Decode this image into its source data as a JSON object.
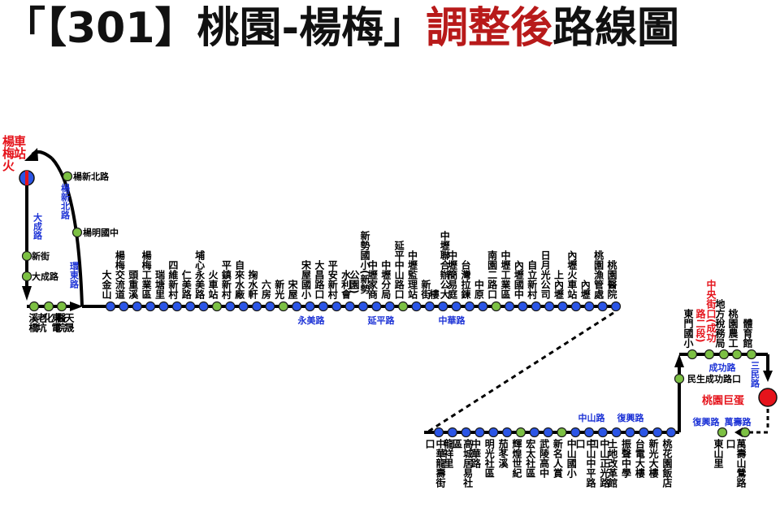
{
  "title": {
    "part1": "「【301】桃園-楊梅」",
    "part2": "調整後",
    "part3": "路線圖"
  },
  "colors": {
    "route": "#000000",
    "stop_blue": "#2b55e6",
    "stop_green": "#7cc043",
    "road_label": "#1d33d6",
    "terminal_red": "#e5131b",
    "title_red": "#b81a1a"
  },
  "terminal_yangmei": "楊梅火車站",
  "terminal_taoyuan": "桃園巨蛋",
  "left_stops": [
    "楊新北路",
    "楊明國中",
    "新街",
    "大成路"
  ],
  "bottom_left_stops": [
    "老坑溪橋",
    "東電化",
    "天晟醫院"
  ],
  "upper_stops": [
    "大金山",
    "楊梅交流道",
    "頭重溪",
    "楊梅工業區",
    "瑞塘里",
    "四維新村",
    "仁美路",
    "埔心永美路",
    "火車站",
    "平鎮新村",
    "自來水廠",
    "掬水軒",
    "六房",
    "新光",
    "宋屋",
    "宋屋國小",
    "大昌路口",
    "平安新村",
    "水利會",
    "新勢國小(新勢公園)",
    "中壢家商",
    "中壢分局",
    "延平中山路口",
    "中壢監理站",
    "新街",
    "中壢聯合辦公大樓",
    "中壢簡易庭",
    "台灣拉鍊",
    "中原",
    "南園二路口",
    "中壢工業區",
    "內壢國中",
    "自立新村",
    "日月光公司",
    "上內壢",
    "內壢火車站",
    "內壢",
    "桃園漁管處",
    "桃園醫院"
  ],
  "right_upper_stops": [
    "東門國小",
    "中央街口(成功路二段)",
    "地方稅務局",
    "桃園農工",
    "體育館"
  ],
  "right_mid_stop": "民生成功路口",
  "lower_stops": [
    "中華龍壽街口",
    "龍祥里",
    "高城居易社區",
    "中華路",
    "明光社區",
    "茄苳溪",
    "輝煌世紀",
    "宏太社區",
    "武陵高中",
    "新名人賞",
    "中山國小",
    "中山中平路口",
    "中山正光路口",
    "土地改革館",
    "振聲中學",
    "台電大樓",
    "新光大樓",
    "桃花園飯店"
  ],
  "right_lower_stops": [
    "東山里",
    "萬壽山鶯路口"
  ],
  "road_labels": {
    "dacheng": "大成路",
    "yangxinbei": "楊新北路",
    "huandong": "環東路",
    "yongmei": "永美路",
    "yanping": "延平路",
    "zhonghua": "中華路",
    "zhongshan": "中山路",
    "fuxing": "復興路",
    "fuxing2": "復興路",
    "wanshou": "萬壽路",
    "chenggong": "成功路",
    "sanmin": "三民路"
  }
}
